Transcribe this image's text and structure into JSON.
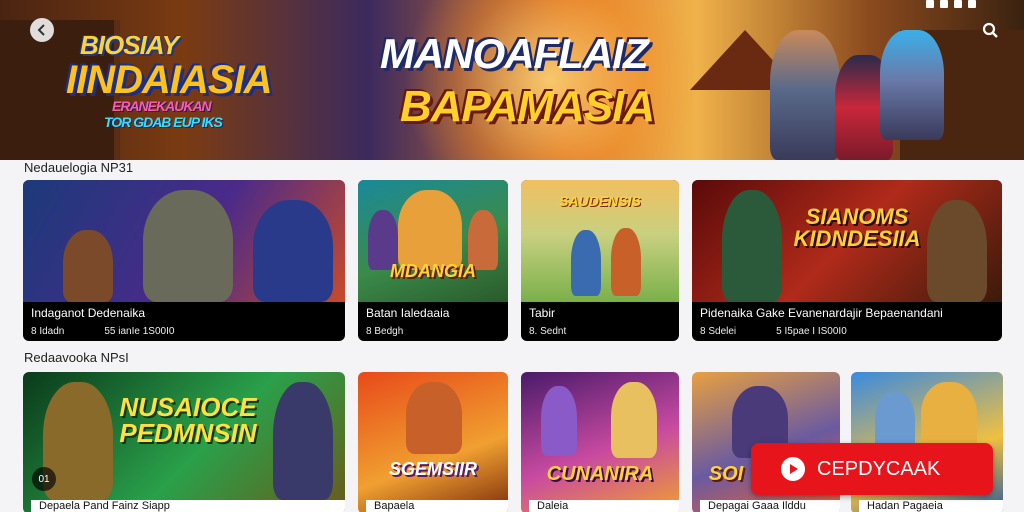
{
  "hero": {
    "title_left_line1": "BIOSIAY",
    "title_left_line2": "IINDAIASIA",
    "title_left_line3": "ERANEKAUKAN",
    "title_left_line4": "TOR GDAB EUP IKS",
    "title_center_line1": "MANOAFLAIZ",
    "title_center_line2": "BAPAMASIA"
  },
  "sections": [
    {
      "label": "Nedauelogia NP31"
    },
    {
      "label": "Redaavooka NPsI"
    }
  ],
  "row1": [
    {
      "art_text": "",
      "name": "Indaganot Dedenaika",
      "meta_left": "8 Idadn",
      "meta_right": "55 ianIe 1S00I0",
      "colors": [
        "#1c3a7a",
        "#4a2a8a",
        "#c84a2a"
      ]
    },
    {
      "art_text": "MDANGIA",
      "name": "Batan Ialedaaia",
      "meta_left": "8 Bedgh",
      "meta_right": "",
      "colors": [
        "#1a8a9a",
        "#e8a03a",
        "#2a5a2a"
      ]
    },
    {
      "art_text": "SAUDENSIS",
      "name": "Tabir",
      "meta_left": "8. Sednt",
      "meta_right": "",
      "colors": [
        "#f0c060",
        "#7ab04a",
        "#5a8a2a"
      ]
    },
    {
      "art_text": "SIANOMS KIDNDESIIA",
      "name": "Pidenaika Gake Evanenardajir Bepaenandani",
      "meta_left": "8 Sdelei",
      "meta_right": "5 I5pae I IS00I0",
      "colors": [
        "#5a0a0a",
        "#b02a1a",
        "#3a1a0a"
      ]
    }
  ],
  "row2": [
    {
      "art_text": "NUSAIOCE PEDMNSIN",
      "bottom": "Depaela Pand Fainz Siapp",
      "colors": [
        "#0a3a1a",
        "#2aa04a",
        "#6a5a1a"
      ]
    },
    {
      "art_text": "SGEMSIIR",
      "bottom": "Bapaela",
      "colors": [
        "#e84a1a",
        "#f0a030",
        "#7a2a0a"
      ]
    },
    {
      "art_text": "CUNANIRA",
      "bottom": "Daleia",
      "colors": [
        "#4a1a6a",
        "#c84aa0",
        "#f0a030"
      ]
    },
    {
      "art_text": "SOI",
      "bottom": "Depagai Gaaa Ilddu",
      "colors": [
        "#e8a040",
        "#6a5aa0",
        "#f06030"
      ]
    },
    {
      "art_text": "",
      "bottom": "Hadan Pagaeia",
      "colors": [
        "#3a8ae0",
        "#f0c040",
        "#2a5aa0"
      ]
    }
  ],
  "cta": {
    "label": "CEPDYCAAK"
  },
  "mute": {
    "label": "01"
  },
  "icons": {
    "back": "arrow-left-icon",
    "search": "search-icon",
    "play": "play-icon"
  }
}
